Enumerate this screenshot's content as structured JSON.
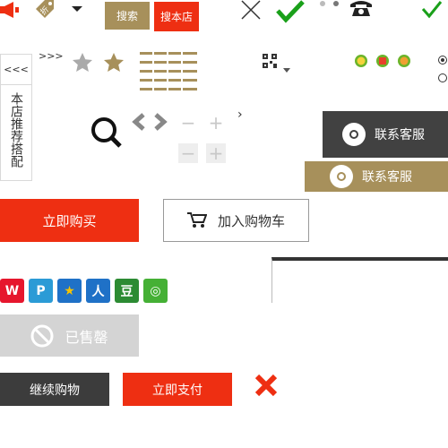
{
  "header": {
    "search_label": "搜索",
    "search_store_label": "搜本店",
    "discount_tag": "折"
  },
  "recommend_panel": {
    "collapse_arrows": "<<<",
    "label": "本店推荐搭配"
  },
  "expand_arrows": ">>>",
  "nav": {
    "right_arrow": "›"
  },
  "service": {
    "contact_dark": "联系客服",
    "contact_gold": "联系客服"
  },
  "actions": {
    "buy_now": "立即购买",
    "add_to_cart": "加入购物车",
    "sold_out": "已售罄",
    "continue_shopping": "继续购物",
    "pay_now": "立即支付"
  },
  "quantity": {
    "minus": "−",
    "plus": "+"
  },
  "share_icons": [
    {
      "name": "weibo-icon",
      "color": "#e6162d"
    },
    {
      "name": "tencent-weibo-icon",
      "color": "#2b9bd6"
    },
    {
      "name": "qzone-icon",
      "color": "#f7c300"
    },
    {
      "name": "renren-icon",
      "color": "#1f71c7"
    },
    {
      "name": "douban-icon",
      "color": "#2c8b33"
    },
    {
      "name": "wechat-icon",
      "color": "#45b035"
    }
  ],
  "colors": {
    "accent_red": "#ee2f12",
    "gold": "#a7905b",
    "dark": "#414141",
    "check_green": "#1aa01a",
    "disabled": "#d4d4d4"
  }
}
